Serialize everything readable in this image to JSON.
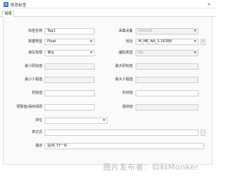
{
  "window": {
    "title": "修改标签",
    "close_glyph": "×"
  },
  "tabs": [
    {
      "label": "常规"
    }
  ],
  "form": {
    "tag_name": {
      "label": "标签名称",
      "value": "Tag1"
    },
    "collect_device": {
      "label": "采集设备",
      "value": "Device1"
    },
    "data_type": {
      "label": "数据类型",
      "value": "Float"
    },
    "address": {
      "label": "地址",
      "value": "M_ME_NA_1,16388"
    },
    "rw_permission": {
      "label": "读写权限",
      "value": "读写"
    },
    "byte_order": {
      "label": "编码类型",
      "value": "No"
    },
    "min_raw": {
      "label": "最小原始值",
      "value": ""
    },
    "max_raw": {
      "label": "最大原始值",
      "value": ""
    },
    "min_eng": {
      "label": "最小工程值",
      "value": ""
    },
    "max_eng": {
      "label": "最大工程值",
      "value": ""
    },
    "initial": {
      "label": "初始值",
      "value": ""
    },
    "deadband": {
      "label": "失效值",
      "value": ""
    },
    "alarm_cond": {
      "label": "预警值/保持调周",
      "value": ""
    },
    "retain": {
      "label": "保持值",
      "value": ""
    },
    "unit": {
      "label": "单位",
      "value": ""
    },
    "expression": {
      "label": "表达式",
      "value": ""
    },
    "description": {
      "label": "描述",
      "value": "遥测, 归一化"
    }
  },
  "watermark": "图片发布者：仰科Monker",
  "colors": {
    "icon_blue": "#2f6fd6",
    "field_border": "#cdcdcd",
    "disabled_bg": "#f3f3f3"
  }
}
